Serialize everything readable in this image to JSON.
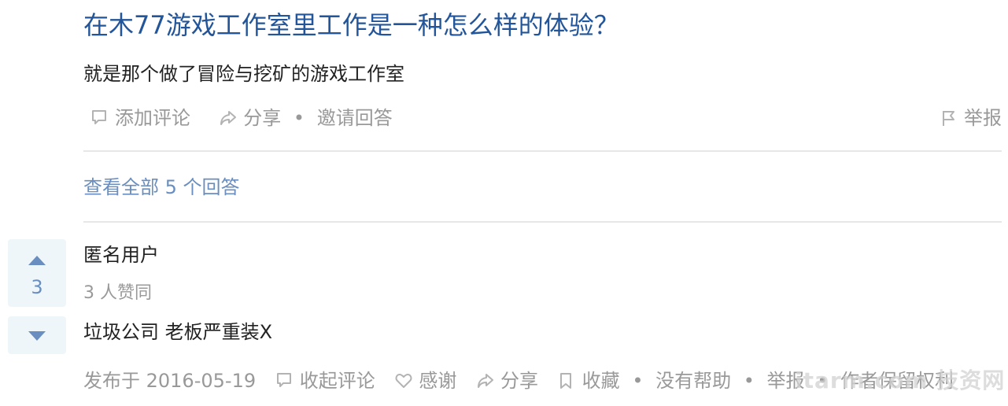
{
  "question": {
    "title": "在木77游戏工作室里工作是一种怎么样的体验？",
    "detail": "就是那个做了冒险与挖矿的游戏工作室",
    "actions": {
      "add_comment": "添加评论",
      "share": "分享",
      "invite": "邀请回答",
      "report": "举报"
    }
  },
  "view_all_answers": "查看全部 5 个回答",
  "answer": {
    "vote_count": "3",
    "author": "匿名用户",
    "vote_summary": "3 人赞同",
    "content": "垃圾公司 老板严重装X",
    "meta": {
      "published": "发布于 2016-05-19",
      "collapse_comments": "收起评论",
      "thanks": "感谢",
      "share": "分享",
      "favorite": "收藏",
      "not_helpful": "没有帮助",
      "report": "举报",
      "copyright": "作者保留权利"
    }
  },
  "watermark": "itarm.com 技资网",
  "colors": {
    "title": "#225599",
    "link": "#698ebf",
    "muted": "#999999",
    "vote_bg": "#eff6fa"
  },
  "icons": [
    "comment-icon",
    "share-arrow-icon",
    "flag-icon",
    "upvote-arrow-icon",
    "downvote-arrow-icon",
    "heart-icon",
    "bookmark-icon"
  ]
}
